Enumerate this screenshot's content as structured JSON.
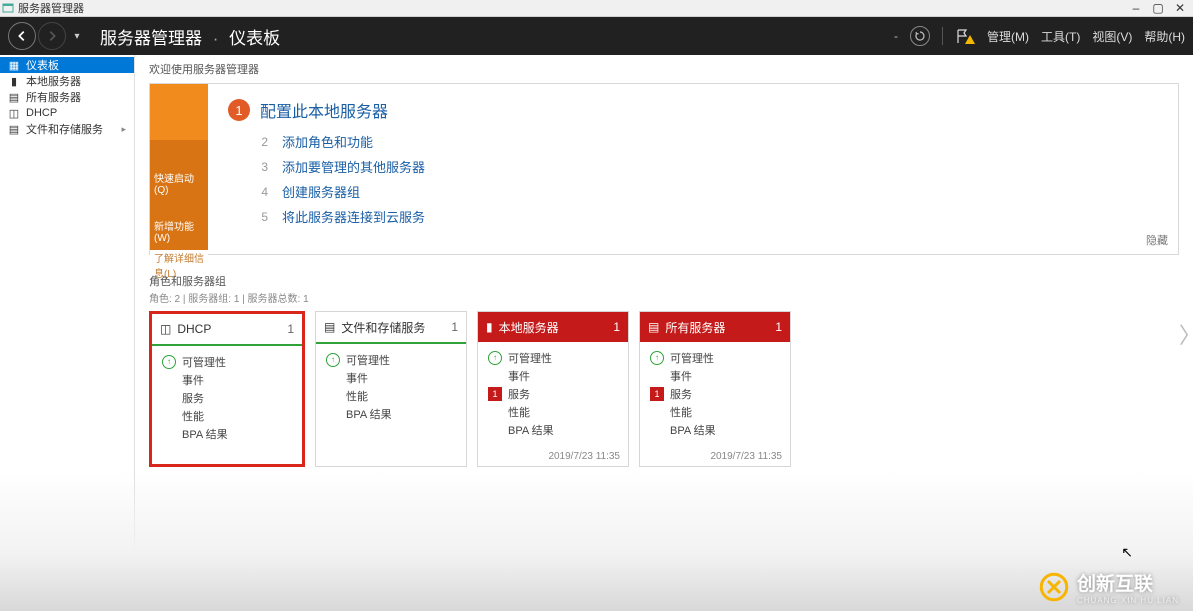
{
  "window": {
    "title": "服务器管理器",
    "min": "–",
    "max": "▢",
    "close": "✕"
  },
  "header": {
    "crumb1": "服务器管理器",
    "crumb2": "仪表板",
    "sep": "·",
    "menus": {
      "manage": "管理(M)",
      "tools": "工具(T)",
      "view": "视图(V)",
      "help": "帮助(H)"
    }
  },
  "sidebar": {
    "dashboard": "仪表板",
    "local": "本地服务器",
    "all": "所有服务器",
    "dhcp": "DHCP",
    "file": "文件和存储服务"
  },
  "welcome": "欢迎使用服务器管理器",
  "qs": {
    "left": {
      "quickstart": "快速启动(Q)",
      "whatsnew": "新增功能(W)",
      "learn": "了解详细信息(L)"
    },
    "num1": "1",
    "headline": "配置此本地服务器",
    "steps": {
      "n2": "2",
      "s2": "添加角色和功能",
      "n3": "3",
      "s3": "添加要管理的其他服务器",
      "n4": "4",
      "s4": "创建服务器组",
      "n5": "5",
      "s5": "将此服务器连接到云服务"
    },
    "hide": "隐藏"
  },
  "section": {
    "title": "角色和服务器组",
    "sub": "角色: 2 | 服务器组: 1 | 服务器总数: 1"
  },
  "tiles": {
    "dhcp": {
      "title": "DHCP",
      "count": "1",
      "rows": {
        "r1": "可管理性",
        "r2": "事件",
        "r3": "服务",
        "r4": "性能",
        "r5": "BPA 结果"
      }
    },
    "file": {
      "title": "文件和存储服务",
      "count": "1",
      "rows": {
        "r1": "可管理性",
        "r2": "事件",
        "r3": "性能",
        "r4": "BPA 结果"
      }
    },
    "local": {
      "title": "本地服务器",
      "count": "1",
      "rows": {
        "r1": "可管理性",
        "r2": "事件",
        "r3n": "1",
        "r3": "服务",
        "r4": "性能",
        "r5": "BPA 结果"
      },
      "time": "2019/7/23 11:35"
    },
    "all": {
      "title": "所有服务器",
      "count": "1",
      "rows": {
        "r1": "可管理性",
        "r2": "事件",
        "r3n": "1",
        "r3": "服务",
        "r4": "性能",
        "r5": "BPA 结果"
      },
      "time": "2019/7/23 11:35"
    }
  },
  "watermark": {
    "zh": "创新互联",
    "py": "CHUANG XIN HU LIAN"
  }
}
